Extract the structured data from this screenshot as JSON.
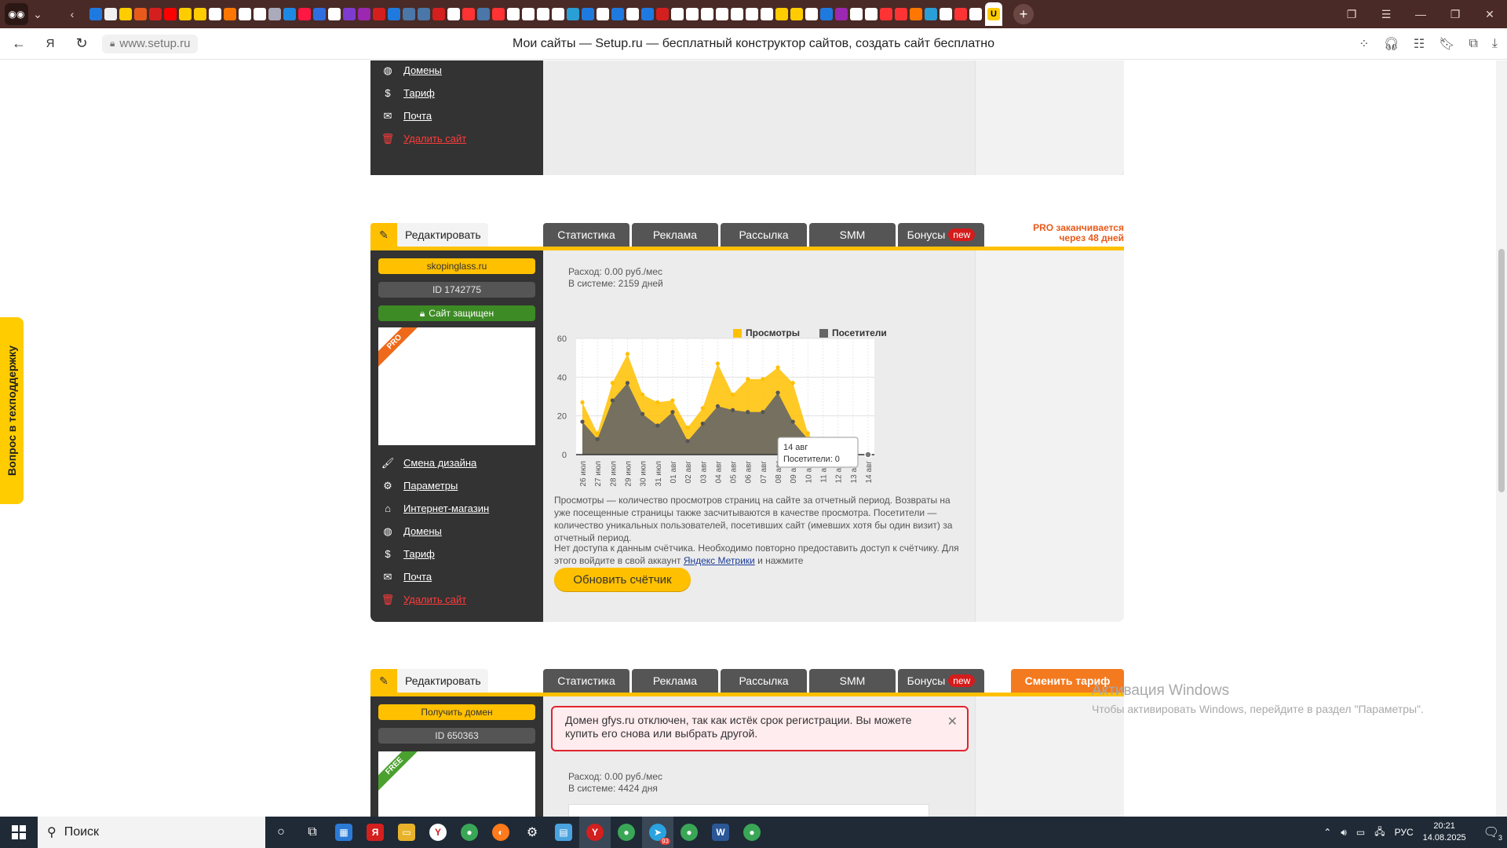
{
  "browser": {
    "url": "www.setup.ru",
    "page_title": "Мои сайты — Setup.ru — бесплатный конструктор сайтов, создать сайт бесплатно",
    "active_tab_icon": "U",
    "tab_icon_colors": [
      "#1f7ae0",
      "#f0f0f0",
      "#ffcc00",
      "#e85a1b",
      "#d41f1f",
      "#ff0000",
      "#ffcc00",
      "#ffcc00",
      "#ffffff",
      "#ff7700",
      "#ffffff",
      "#ffffff",
      "#aab",
      "#1e88e5",
      "#ff1744",
      "#2e6ee0",
      "#ffffff",
      "#7e3bd0",
      "#9c27b0",
      "#d41f1f",
      "#1f7ae0",
      "#4a76a8",
      "#4a76a8",
      "#d41f1f",
      "#ffffff",
      "#ff3333",
      "#4a76a8",
      "#ff3333",
      "#ffffff",
      "#ffffff",
      "#ffffff",
      "#ffffff",
      "#2a9fd6",
      "#1f7ae0",
      "#ffffff",
      "#1f7ae0",
      "#ffffff",
      "#1f7ae0",
      "#d41f1f",
      "#ffffff",
      "#ffffff",
      "#ffffff",
      "#ffffff",
      "#ffffff",
      "#ffffff",
      "#ffffff",
      "#ffcc00",
      "#ffcc00",
      "#ffffff",
      "#1f7ae0",
      "#9c27b0",
      "#ffffff",
      "#ffffff",
      "#ff3333",
      "#ff3333",
      "#ff7700",
      "#2a9fd6",
      "#ffffff",
      "#ff3333",
      "#ffffff"
    ]
  },
  "support_tab": "Вопрос в техподдержку",
  "menu_items": [
    {
      "icon": "brush-icon",
      "label": "Смена дизайна",
      "danger": false
    },
    {
      "icon": "gear-icon",
      "label": "Параметры",
      "danger": false
    },
    {
      "icon": "shop-icon",
      "label": "Интернет-магазин",
      "danger": false
    },
    {
      "icon": "globe-icon",
      "label": "Домены",
      "danger": false
    },
    {
      "icon": "tariff-icon",
      "label": "Тариф",
      "danger": false
    },
    {
      "icon": "mail-icon",
      "label": "Почта",
      "danger": false
    },
    {
      "icon": "trash-icon",
      "label": "Удалить сайт",
      "danger": true
    }
  ],
  "top_menu_items": [
    {
      "icon": "globe-icon",
      "label": "Домены",
      "danger": false
    },
    {
      "icon": "tariff-icon",
      "label": "Тариф",
      "danger": false
    },
    {
      "icon": "mail-icon",
      "label": "Почта",
      "danger": false
    },
    {
      "icon": "trash-icon",
      "label": "Удалить сайт",
      "danger": true
    }
  ],
  "card_common": {
    "edit_label": "Редактировать",
    "tabs": [
      "Статистика",
      "Реклама",
      "Рассылка",
      "SMM",
      "Бонусы"
    ],
    "new_badge": "new"
  },
  "site1": {
    "domain": "skopinglass.ru",
    "id": "ID 1742775",
    "protected": "Сайт защищен",
    "ribbon": "PRO",
    "pro_note_line1": "PRO заканчивается",
    "pro_note_line2": "через 48 дней",
    "expense": "Расход: 0.00 руб./мес",
    "days": "В системе: 2159 дней",
    "desc1": "Просмотры — количество просмотров страниц на сайте за отчетный период. Возвраты на уже посещенные страницы также засчитываются в качестве просмотра. Посетители — количество уникальных пользователей, посетивших сайт (имевших хотя бы один визит) за отчетный период.",
    "desc2_a": "Нет доступа к данным счётчика. Необходимо повторно предоставить доступ к счётчику. Для этого войдите в свой аккаунт ",
    "desc2_link": "Яндекс Метрики",
    "desc2_b": " и нажмите",
    "refresh_button": "Обновить счётчик",
    "tooltip_date": "14 авг",
    "tooltip_value": "Посетители: 0"
  },
  "site2": {
    "domain_button": "Получить домен",
    "id": "ID 650363",
    "ribbon": "FREE",
    "change_plan": "Сменить тариф",
    "alert": "Домен gfys.ru отключен, так как истёк срок регистрации. Вы можете купить его снова или выбрать другой.",
    "expense": "Расход: 0.00 руб./мес",
    "days": "В системе: 4424 дня"
  },
  "chart_data": {
    "type": "area",
    "categories": [
      "26 июл",
      "27 июл",
      "28 июл",
      "29 июл",
      "30 июл",
      "31 июл",
      "01 авг",
      "02 авг",
      "03 авг",
      "04 авг",
      "05 авг",
      "06 авг",
      "07 авг",
      "08 авг",
      "09 авг",
      "10 авг",
      "11 авг",
      "12 авг",
      "13 авг",
      "14 авг"
    ],
    "series": [
      {
        "name": "Просмотры",
        "color": "#ffc000",
        "values": [
          27,
          11,
          37,
          52,
          31,
          27,
          28,
          14,
          24,
          47,
          31,
          39,
          39,
          45,
          37,
          11,
          0,
          0,
          0,
          0
        ]
      },
      {
        "name": "Посетители",
        "color": "#666666",
        "values": [
          17,
          8,
          28,
          37,
          21,
          15,
          22,
          7,
          16,
          25,
          23,
          22,
          22,
          32,
          17,
          8,
          0,
          0,
          0,
          0
        ]
      }
    ],
    "ylim": [
      0,
      60
    ],
    "yticks": [
      0,
      20,
      40,
      60
    ],
    "grid": true,
    "legend": "top-right"
  },
  "activation": {
    "line1": "Активация Windows",
    "line2": "Чтобы активировать Windows, перейдите в раздел \"Параметры\"."
  },
  "taskbar": {
    "search_placeholder": "Поиск",
    "telegram_badge": "93",
    "lang": "РУС",
    "time": "20:21",
    "date": "14.08.2025",
    "notifications": "3"
  }
}
